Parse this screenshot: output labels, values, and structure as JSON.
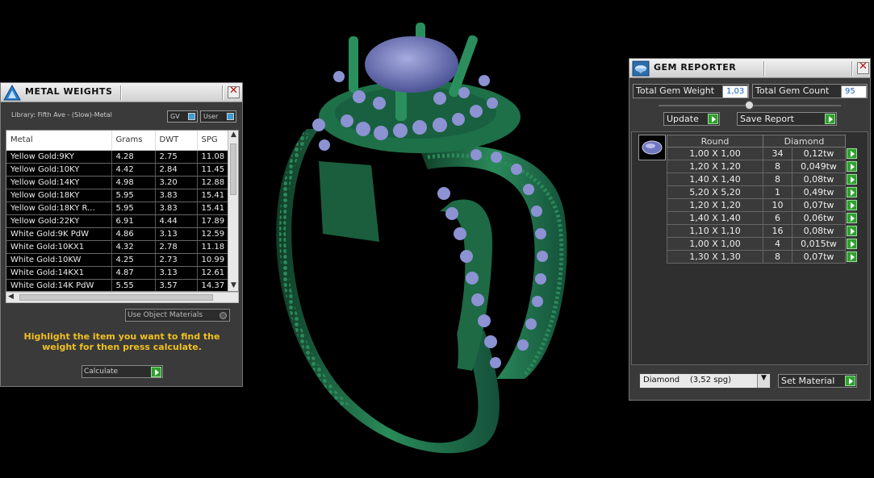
{
  "metal_weights": {
    "title": "METAL WEIGHTS",
    "library": "Library: Fifth Ave - (Slow)-Metal",
    "gv_toggle": "GV",
    "user_toggle": "User",
    "columns": [
      "Metal",
      "Grams",
      "DWT",
      "SPG"
    ],
    "rows": [
      [
        "Yellow Gold:9KY",
        "4.28",
        "2.75",
        "11.08"
      ],
      [
        "Yellow Gold:10KY",
        "4.42",
        "2.84",
        "11.45"
      ],
      [
        "Yellow Gold:14KY",
        "4.98",
        "3.20",
        "12.88"
      ],
      [
        "Yellow Gold:18KY",
        "5.95",
        "3.83",
        "15.41"
      ],
      [
        "Yellow Gold:18KY R...",
        "5.95",
        "3.83",
        "15.41"
      ],
      [
        "Yellow Gold:22KY",
        "6.91",
        "4.44",
        "17.89"
      ],
      [
        "White Gold:9K PdW",
        "4.86",
        "3.13",
        "12.59"
      ],
      [
        "White Gold:10KX1",
        "4.32",
        "2.78",
        "11.18"
      ],
      [
        "White Gold:10KW",
        "4.25",
        "2.73",
        "10.99"
      ],
      [
        "White Gold:14KX1",
        "4.87",
        "3.13",
        "12.61"
      ],
      [
        "White Gold:14K PdW",
        "5.55",
        "3.57",
        "14.37"
      ]
    ],
    "use_object_materials": "Use Object Materials",
    "hint": "Highlight the item you want to find the weight for then press calculate.",
    "calculate_label": "Calculate"
  },
  "gem_reporter": {
    "title": "GEM REPORTER",
    "total_weight_label": "Total Gem Weight",
    "total_weight_value": "1,03",
    "total_count_label": "Total Gem Count",
    "total_count_value": "95",
    "update_label": "Update",
    "save_report_label": "Save Report",
    "shape_header": "Round",
    "material_header": "Diamond",
    "gems": [
      [
        "1,00 X 1,00",
        "34",
        "0,12tw"
      ],
      [
        "1,20 X 1,20",
        "8",
        "0,049tw"
      ],
      [
        "1,40 X 1,40",
        "8",
        "0,08tw"
      ],
      [
        "5,20 X 5,20",
        "1",
        "0,49tw"
      ],
      [
        "1,20 X 1,20",
        "10",
        "0,07tw"
      ],
      [
        "1,40 X 1,40",
        "6",
        "0,06tw"
      ],
      [
        "1,10 X 1,10",
        "16",
        "0,08tw"
      ],
      [
        "1,00 X 1,00",
        "4",
        "0,015tw"
      ],
      [
        "1,30 X 1,30",
        "8",
        "0,07tw"
      ]
    ],
    "material_select": "Diamond    (3,52 spg)",
    "set_material_label": "Set Material"
  },
  "colors": {
    "ring_metal": "#1f6e48",
    "gem_blue": "#7e86c8",
    "hint_text": "#f0c020",
    "go_button": "#2ea02e"
  }
}
